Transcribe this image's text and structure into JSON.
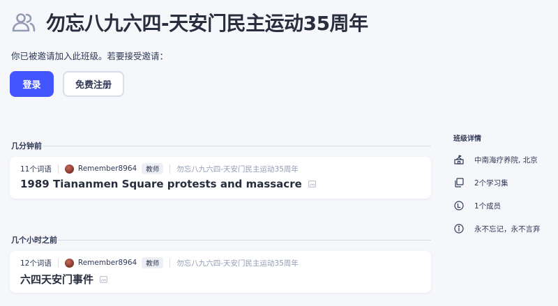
{
  "header": {
    "title": "勿忘八九六四-天安门民主运动35周年",
    "icon": "class-group-icon"
  },
  "invite": {
    "message": "你已被邀请加入此班级。若要接受邀请："
  },
  "buttons": {
    "login": "登录",
    "signup": "免费注册"
  },
  "colors": {
    "primary": "#4255ff",
    "text": "#2e3856",
    "muted": "#939bb4",
    "background": "#f6f7fb"
  },
  "sections": [
    {
      "label": "几分钟前",
      "set": {
        "term_count": "11个词语",
        "author": "Remember8964",
        "role_badge": "教师",
        "class_name": "勿忘八九六四-天安门民主运动35周年",
        "title": "1989 Tiananmen Square protests and massacre"
      }
    },
    {
      "label": "几个小时之前",
      "set": {
        "term_count": "12个词语",
        "author": "Remember8964",
        "role_badge": "教师",
        "class_name": "勿忘八九六四-天安门民主运动35周年",
        "title": "六四天安门事件"
      }
    }
  ],
  "sidebar": {
    "title": "班级详情",
    "details": [
      {
        "icon": "school-building-icon",
        "text": "中南海疗养院, 北京"
      },
      {
        "icon": "study-sets-icon",
        "text": "2个学习集"
      },
      {
        "icon": "member-icon",
        "text": "1个成员"
      },
      {
        "icon": "info-icon",
        "text": "永不忘记，永不言弃"
      }
    ]
  }
}
